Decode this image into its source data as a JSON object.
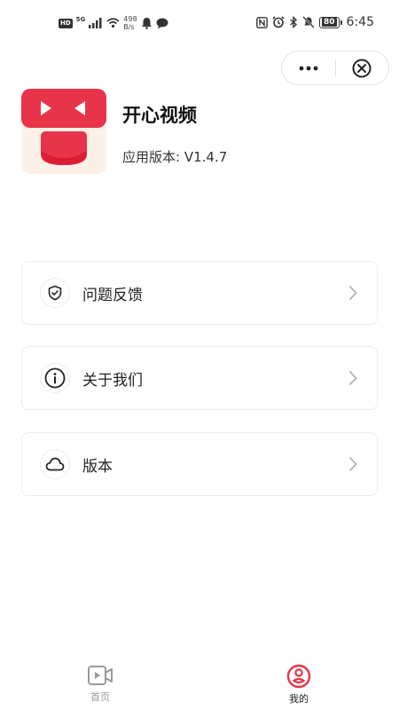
{
  "status_bar": {
    "hd": "HD",
    "network": "5G",
    "speed_value": "498",
    "speed_unit": "B/s",
    "battery": "80",
    "time": "6:45"
  },
  "app": {
    "name": "开心视频",
    "version_label": "应用版本: V1.4.7"
  },
  "menu": [
    {
      "label": "问题反馈",
      "icon": "shield-check-icon"
    },
    {
      "label": "关于我们",
      "icon": "info-icon"
    },
    {
      "label": "版本",
      "icon": "cloud-icon"
    }
  ],
  "bottom_nav": [
    {
      "label": "首页",
      "icon": "video-icon",
      "active": false
    },
    {
      "label": "我的",
      "icon": "profile-icon",
      "active": true
    }
  ],
  "colors": {
    "brand_red": "#e8344a",
    "logo_bg": "#fdf0e6",
    "inactive": "#999999"
  }
}
